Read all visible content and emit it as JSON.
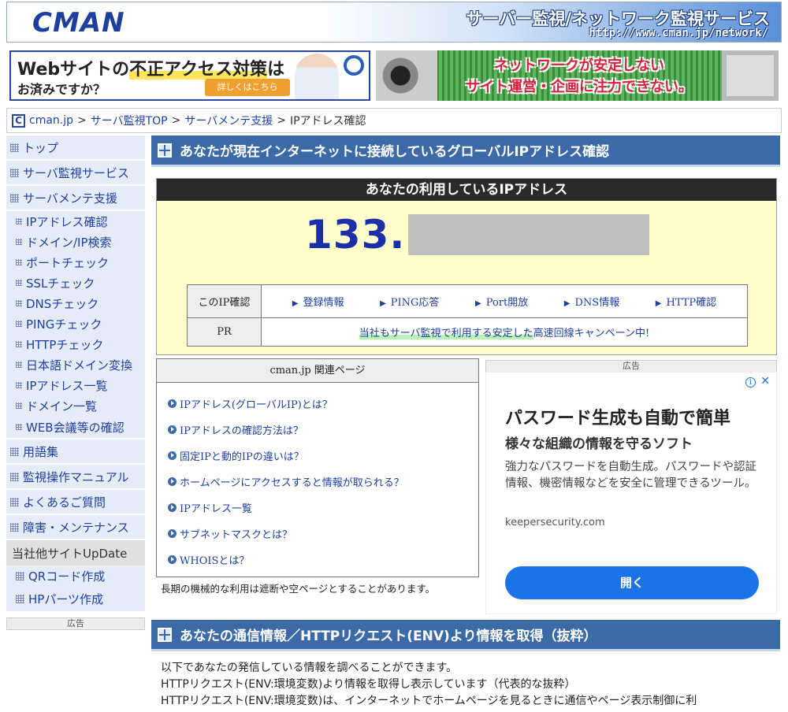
{
  "header": {
    "logo": "CMAN",
    "tagline": "サーバー監視/ネットワーク監視サービス",
    "url": "http://www.cman.jp/network/"
  },
  "banners": {
    "left": {
      "line1_pre": "Webサイトの",
      "line1_highlight": "不正アクセス対策",
      "line1_post": "は",
      "line2": "お済みですか？",
      "button": "詳しくはこちら"
    },
    "right": {
      "line1": "ネットワークが安定しない",
      "line2": "サイト運営・企画に注力できない。"
    }
  },
  "breadcrumb": {
    "logo": "C",
    "items": [
      "cman.jp",
      "サーバ監視TOP",
      "サーバメンテ支援",
      "IPアドレス確認"
    ],
    "separator": ">"
  },
  "sidebar": {
    "main1": [
      "トップ",
      "サーバ監視サービス",
      "サーバメンテ支援"
    ],
    "sub": [
      "IPアドレス確認",
      "ドメイン/IP検索",
      "ポートチェック",
      "SSLチェック",
      "DNSチェック",
      "PINGチェック",
      "HTTPチェック",
      "日本語ドメイン変換",
      "IPアドレス一覧",
      "ドメイン一覧",
      "WEB会議等の確認"
    ],
    "main2": [
      "用語集",
      "監視操作マニュアル",
      "よくあるご質問",
      "障害・メンテナンス"
    ],
    "update_header": "当社他サイトUpDate",
    "update_items": [
      "QRコード作成",
      "HPパーツ作成"
    ],
    "ad_label": "広告"
  },
  "main": {
    "section1_title": "あなたが現在インターネットに接続しているグローバルIPアドレス確認",
    "ip_box_title": "あなたの利用しているIPアドレス",
    "ip_prefix": "133.",
    "table": {
      "row1_label": "このIP確認",
      "links": [
        "登録情報",
        "PING応答",
        "Port開放",
        "DNS情報",
        "HTTP確認"
      ],
      "row2_label": "PR",
      "pr_highlight": "当社もサーバ監視で利用する安定した",
      "pr_rest": "高速回線キャンペーン中!"
    },
    "related": {
      "title": "cman.jp 関連ページ",
      "items": [
        "IPアドレス(グローバルIP)とは？",
        "IPアドレスの確認方法は？",
        "固定IPと動的IPの違いは？",
        "ホームページにアクセスすると情報が取られる？",
        "IPアドレス一覧",
        "サブネットマスクとは？",
        "WHOISとは？"
      ]
    },
    "note": "長期の機械的な利用は遮断や空ページとすることがあります。",
    "ad": {
      "label": "広告",
      "headline": "パスワード生成も自動で簡単",
      "subheadline": "様々な組織の情報を守るソフト",
      "body": "強力なパスワードを自動生成。パスワードや認証情報、機密情報などを安全に管理できるツール。",
      "domain": "keepersecurity.com",
      "button": "開く"
    },
    "section2_title": "あなたの通信情報／HTTPリクエスト(ENV)より情報を取得（抜粋）",
    "env_lines": [
      "以下であなたの発信している情報を調べることができます。",
      "HTTPリクエスト(ENV:環境変数)より情報を取得し表示しています（代表的な抜粋）",
      "HTTPリクエスト(ENV:環境変数)は、インターネットでホームページを見るときに通信やページ表示制御に利"
    ]
  }
}
